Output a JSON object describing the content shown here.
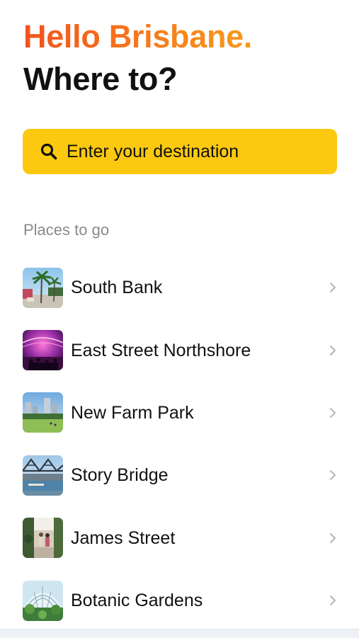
{
  "header": {
    "greeting": "Hello Brisbane.",
    "title": "Where to?"
  },
  "search": {
    "icon": "search-icon",
    "placeholder": "Enter your destination",
    "background_color": "#fcc910"
  },
  "places": {
    "section_label": "Places to go",
    "items": [
      {
        "name": "South Bank",
        "thumbnail": "south-bank-thumbnail",
        "chevron": "chevron-right-icon"
      },
      {
        "name": "East Street Northshore",
        "thumbnail": "east-street-northshore-thumbnail",
        "chevron": "chevron-right-icon"
      },
      {
        "name": "New Farm Park",
        "thumbnail": "new-farm-park-thumbnail",
        "chevron": "chevron-right-icon"
      },
      {
        "name": "Story Bridge",
        "thumbnail": "story-bridge-thumbnail",
        "chevron": "chevron-right-icon"
      },
      {
        "name": "James Street",
        "thumbnail": "james-street-thumbnail",
        "chevron": "chevron-right-icon"
      },
      {
        "name": "Botanic Gardens",
        "thumbnail": "botanic-gardens-thumbnail",
        "chevron": "chevron-right-icon"
      }
    ]
  },
  "colors": {
    "greeting_gradient_start": "#f4511e",
    "greeting_gradient_end": "#f79a1e",
    "title": "#111111",
    "section_label": "#8a8a8a",
    "chevron": "#b5b5b5"
  }
}
